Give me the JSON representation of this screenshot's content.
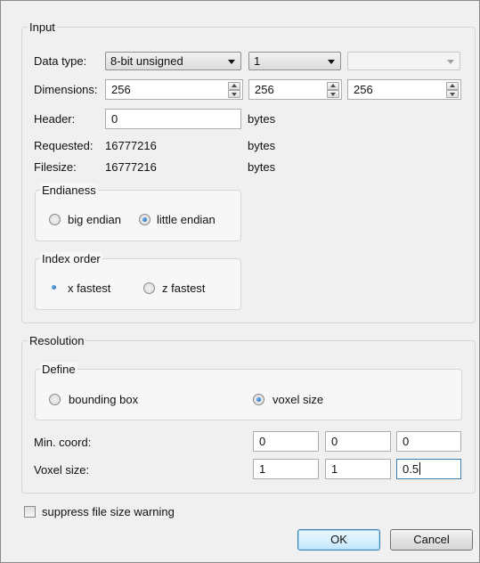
{
  "input": {
    "title": "Input",
    "data_type": {
      "label": "Data type:",
      "type_value": "8-bit unsigned",
      "components_value": "1",
      "third_value": ""
    },
    "dimensions": {
      "label": "Dimensions:",
      "x": "256",
      "y": "256",
      "z": "256"
    },
    "header": {
      "label": "Header:",
      "value": "0",
      "unit": "bytes"
    },
    "requested": {
      "label": "Requested:",
      "value": "16777216",
      "unit": "bytes"
    },
    "filesize": {
      "label": "Filesize:",
      "value": "16777216",
      "unit": "bytes"
    },
    "endianess": {
      "title": "Endianess",
      "options": [
        "big endian",
        "little endian"
      ],
      "selected": "little endian"
    },
    "index_order": {
      "title": "Index order",
      "options": [
        "x fastest",
        "z fastest"
      ],
      "selected": "x fastest"
    }
  },
  "resolution": {
    "title": "Resolution",
    "define": {
      "title": "Define",
      "options": [
        "bounding box",
        "voxel size"
      ],
      "selected": "voxel size"
    },
    "min_coord": {
      "label": "Min. coord:",
      "x": "0",
      "y": "0",
      "z": "0"
    },
    "voxel_size": {
      "label": "Voxel size:",
      "x": "1",
      "y": "1",
      "z": "0.5"
    }
  },
  "suppress_warning": {
    "label": "suppress file size warning",
    "checked": false
  },
  "buttons": {
    "ok": "OK",
    "cancel": "Cancel"
  },
  "icons": [
    "combo-arrow-icon",
    "spin-up-icon",
    "spin-down-icon",
    "radio-icon",
    "checkbox-icon"
  ],
  "colors": {
    "background": "#f0f0f0",
    "accent": "#3c7fb1"
  }
}
